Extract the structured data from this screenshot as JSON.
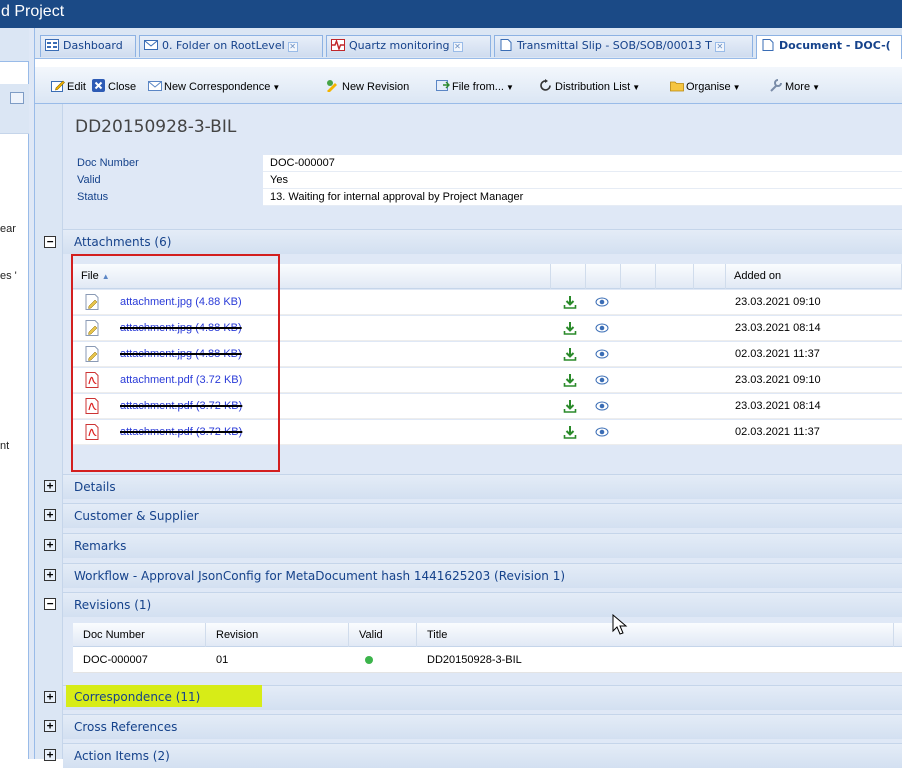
{
  "window": {
    "title": "d Project"
  },
  "left_panel": {
    "snippets": [
      "ear",
      "es '",
      "nt"
    ]
  },
  "tabs": [
    {
      "label": "Dashboard",
      "icon": "dashboard-icon",
      "closable": false,
      "active": false
    },
    {
      "label": "0. Folder on RootLevel",
      "icon": "envelope-icon",
      "closable": true,
      "active": false
    },
    {
      "label": "Quartz monitoring",
      "icon": "pulse-icon",
      "closable": true,
      "active": false
    },
    {
      "label": "Transmittal Slip - SOB/SOB/00013 T",
      "icon": "document-icon",
      "closable": true,
      "active": false
    },
    {
      "label": "Document - DOC-(",
      "icon": "document-icon",
      "closable": false,
      "active": true
    }
  ],
  "toolbar": {
    "edit": "Edit",
    "close": "Close",
    "new_correspondence": "New Correspondence",
    "new_revision": "New Revision",
    "file_from": "File from...",
    "distribution_list": "Distribution List",
    "organise": "Organise",
    "more": "More"
  },
  "document": {
    "title": "DD20150928-3-BIL",
    "fields": [
      {
        "label": "Doc Number",
        "value": "DOC-000007"
      },
      {
        "label": "Valid",
        "value": "Yes"
      },
      {
        "label": "Status",
        "value": "13. Waiting for internal approval by Project Manager"
      }
    ]
  },
  "attachments": {
    "header": "Attachments (6)",
    "col_file": "File",
    "col_added": "Added on",
    "rows": [
      {
        "name": "attachment.jpg (4.88 KB)",
        "type": "image",
        "deleted": false,
        "added": "23.03.2021 09:10"
      },
      {
        "name": "attachment.jpg (4.88 KB)",
        "type": "image",
        "deleted": true,
        "added": "23.03.2021 08:14"
      },
      {
        "name": "attachment.jpg (4.88 KB)",
        "type": "image",
        "deleted": true,
        "added": "02.03.2021 11:37"
      },
      {
        "name": "attachment.pdf (3.72 KB)",
        "type": "pdf",
        "deleted": false,
        "added": "23.03.2021 09:10"
      },
      {
        "name": "attachment.pdf (3.72 KB)",
        "type": "pdf",
        "deleted": true,
        "added": "23.03.2021 08:14"
      },
      {
        "name": "attachment.pdf (3.72 KB)",
        "type": "pdf",
        "deleted": true,
        "added": "02.03.2021 11:37"
      }
    ]
  },
  "sections": {
    "details": "Details",
    "customer_supplier": "Customer & Supplier",
    "remarks": "Remarks",
    "workflow": "Workflow - Approval JsonConfig for MetaDocument hash 1441625203 (Revision 1)",
    "revisions": "Revisions (1)",
    "correspondence": "Correspondence (11)",
    "cross_references": "Cross References",
    "action_items": "Action Items (2)"
  },
  "revisions": {
    "columns": {
      "doc_number": "Doc Number",
      "revision": "Revision",
      "valid": "Valid",
      "title": "Title"
    },
    "rows": [
      {
        "doc_number": "DOC-000007",
        "revision": "01",
        "valid": true,
        "title": "DD20150928-3-BIL"
      }
    ]
  },
  "colors": {
    "accent": "#15428b",
    "highlight": "#d7ec17",
    "annotation_box": "#d31f1f",
    "link": "#2a3bd8"
  }
}
